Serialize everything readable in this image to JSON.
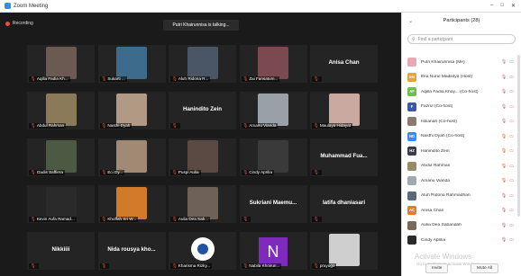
{
  "window": {
    "title": "Zoom Meeting"
  },
  "meeting": {
    "recording_label": "Recording",
    "talking_banner": "Putri Khairunnisa is talking..."
  },
  "tiles": [
    {
      "name": "Aqilla Fadia Kh...",
      "kind": "video",
      "color": "#6b5a52"
    },
    {
      "name": "Sukarti ...",
      "kind": "video",
      "color": "#3d6b8c"
    },
    {
      "name": "Aluh Ridona R...",
      "kind": "video",
      "color": "#4a5566"
    },
    {
      "name": "Zai Fansatum...",
      "kind": "video",
      "color": "#7a4a50"
    },
    {
      "big": "Anisa Chan",
      "kind": "text"
    },
    {
      "name": "Abdul Rahman",
      "kind": "video",
      "color": "#8a7a5a"
    },
    {
      "name": "Nasthi Dyah",
      "kind": "video",
      "color": "#b09a86"
    },
    {
      "big": "Hanindito Zein",
      "kind": "text"
    },
    {
      "name": "Amanu Vianda",
      "kind": "video",
      "color": "#9aa0a8"
    },
    {
      "name": "Maulaya Hidayat",
      "kind": "video",
      "color": "#c9a9a0"
    },
    {
      "name": "Gadis Saffiera",
      "kind": "video",
      "color": "#4d5a43"
    },
    {
      "name": "Eci Dy...",
      "kind": "video",
      "color": "#a08a76"
    },
    {
      "name": "Puspi Aulia",
      "kind": "video",
      "color": "#5b4a44"
    },
    {
      "name": "Cindy Aprilia",
      "kind": "video",
      "color": "#3a3a3a"
    },
    {
      "big": "Muhammad Fua...",
      "kind": "text"
    },
    {
      "name": "Kevin Aufa Ramad...",
      "kind": "video",
      "color": "#2a2a2a"
    },
    {
      "name": "Khoffah Sri W...",
      "kind": "video",
      "color": "#d07a2a"
    },
    {
      "name": "Aulia Dea Sab...",
      "kind": "video",
      "color": "#6e6258"
    },
    {
      "big": "Sukriani Maemu...",
      "kind": "text"
    },
    {
      "big": "latifa dhaniasari",
      "kind": "text"
    },
    {
      "big": "Nikkiiii",
      "kind": "text"
    },
    {
      "big": "Nida rousya kho...",
      "kind": "text"
    },
    {
      "name": "Kharisma Rizky...",
      "kind": "logo"
    },
    {
      "name": "Nabila Khoirun...",
      "kind": "letter",
      "letter": "N"
    },
    {
      "name": "prayugo",
      "kind": "video",
      "color": "#cfcfcf"
    }
  ],
  "sidebar": {
    "title": "Participants (28)",
    "search_placeholder": "Find a participant",
    "participants": [
      {
        "name": "Putri Khairunnisa (Me)",
        "initials": "",
        "color": "#e8a9b5"
      },
      {
        "name": "Eka Nurul Madiidya (Host)",
        "initials": "EN",
        "color": "#e6a23c"
      },
      {
        "name": "Aqilla Fadia Khay... (Co-host)",
        "initials": "AF",
        "color": "#6cc04a"
      },
      {
        "name": "Fazrul (Co-host)",
        "initials": "F",
        "color": "#3a5aa0"
      },
      {
        "name": "Istiianah (Co-host)",
        "initials": "",
        "color": "#8a7a6a"
      },
      {
        "name": "Nasthi Dyah (Co-host)",
        "initials": "ND",
        "color": "#2d8cff"
      },
      {
        "name": "Hanindito Zein",
        "initials": "HZ",
        "color": "#3a3a4a"
      },
      {
        "name": "Abdul Rahman",
        "initials": "",
        "color": "#9a8a6a"
      },
      {
        "name": "Amanu Vianda",
        "initials": "",
        "color": "#a0a8b0"
      },
      {
        "name": "Aluh Ridona Rahmadhan",
        "initials": "",
        "color": "#5a6a7a"
      },
      {
        "name": "Anisa Chan",
        "initials": "AC",
        "color": "#e07a3a"
      },
      {
        "name": "Aulia Dea Sabandah",
        "initials": "",
        "color": "#7a6a5a"
      },
      {
        "name": "Cindy Aprilia",
        "initials": "",
        "color": "#2a2a2a"
      }
    ],
    "watermark_title": "Activate Windows",
    "watermark_sub": "Go to Settings to activate Windows.",
    "invite_label": "Invite",
    "mute_all_label": "Mute All"
  }
}
